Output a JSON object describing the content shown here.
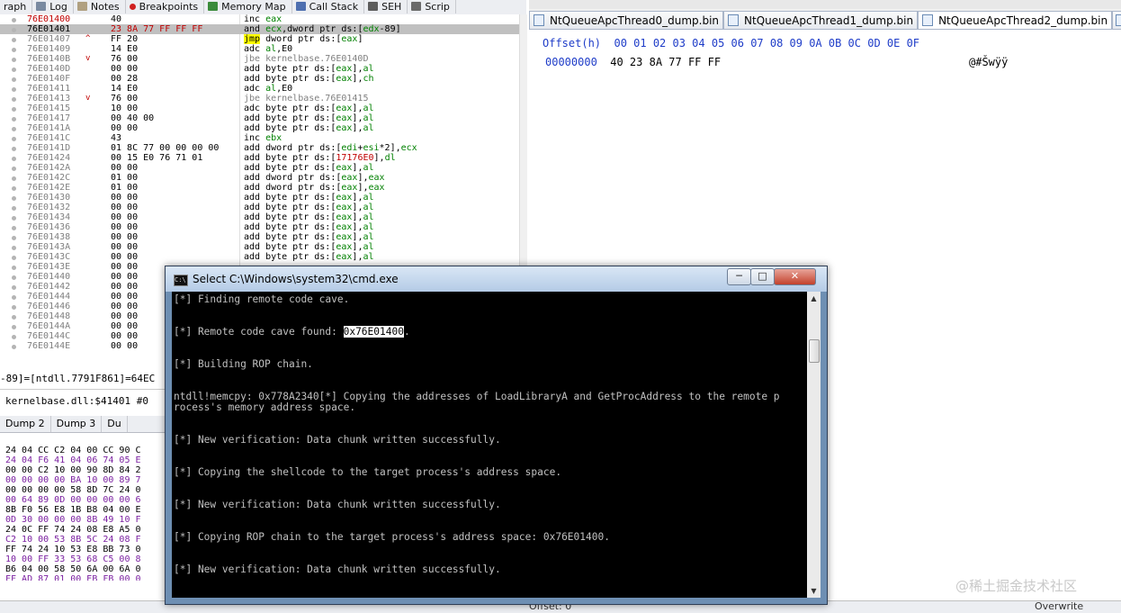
{
  "debugger_tabs": [
    {
      "icon": "graph-icon",
      "label": "raph"
    },
    {
      "icon": "log-icon",
      "label": "Log"
    },
    {
      "icon": "notes-icon",
      "label": "Notes"
    },
    {
      "icon": "breakpoint-icon",
      "label": "Breakpoints"
    },
    {
      "icon": "memory-map-icon",
      "label": "Memory Map"
    },
    {
      "icon": "call-stack-icon",
      "label": "Call Stack"
    },
    {
      "icon": "seh-icon",
      "label": "SEH"
    },
    {
      "icon": "script-icon",
      "label": "Scrip"
    }
  ],
  "disasm_rows": [
    {
      "addr": "76E01400",
      "mk": "",
      "bytes": "40",
      "ins": "inc eax",
      "sel": false,
      "addr_red": true
    },
    {
      "addr": "76E01401",
      "mk": "",
      "bytes": "23 8A 77 FF FF FF",
      "ins": "and ecx,dword ptr ds:[edx-89]",
      "sel": true,
      "addr_red": false
    },
    {
      "addr": "76E01407",
      "mk": "^",
      "bytes": "FF 20",
      "ins": "jmp dword ptr ds:[eax]",
      "sel": false,
      "addr_red": false
    },
    {
      "addr": "76E01409",
      "mk": "",
      "bytes": "14 E0",
      "ins": "adc al,E0",
      "sel": false,
      "addr_red": false
    },
    {
      "addr": "76E0140B",
      "mk": "v",
      "bytes": "76 00",
      "ins": "jbe kernelbase.76E0140D",
      "sel": false,
      "addr_red": false
    },
    {
      "addr": "76E0140D",
      "mk": "",
      "bytes": "00 00",
      "ins": "add byte ptr ds:[eax],al",
      "sel": false,
      "addr_red": false
    },
    {
      "addr": "76E0140F",
      "mk": "",
      "bytes": "00 28",
      "ins": "add byte ptr ds:[eax],ch",
      "sel": false,
      "addr_red": false
    },
    {
      "addr": "76E01411",
      "mk": "",
      "bytes": "14 E0",
      "ins": "adc al,E0",
      "sel": false,
      "addr_red": false
    },
    {
      "addr": "76E01413",
      "mk": "v",
      "bytes": "76 00",
      "ins": "jbe kernelbase.76E01415",
      "sel": false,
      "addr_red": false
    },
    {
      "addr": "76E01415",
      "mk": "",
      "bytes": "10 00",
      "ins": "adc byte ptr ds:[eax],al",
      "sel": false,
      "addr_red": false
    },
    {
      "addr": "76E01417",
      "mk": "",
      "bytes": "00 40 00",
      "ins": "add byte ptr ds:[eax],al",
      "sel": false,
      "addr_red": false
    },
    {
      "addr": "76E0141A",
      "mk": "",
      "bytes": "00 00",
      "ins": "add byte ptr ds:[eax],al",
      "sel": false,
      "addr_red": false
    },
    {
      "addr": "76E0141C",
      "mk": "",
      "bytes": "43",
      "ins": "inc ebx",
      "sel": false,
      "addr_red": false
    },
    {
      "addr": "76E0141D",
      "mk": "",
      "bytes": "01 8C 77 00 00 00 00",
      "ins": "add dword ptr ds:[edi+esi*2],ecx",
      "sel": false,
      "addr_red": false
    },
    {
      "addr": "76E01424",
      "mk": "",
      "bytes": "00 15 E0 76 71 01",
      "ins": "add byte ptr ds:[17176E0],dl",
      "sel": false,
      "addr_red": false
    },
    {
      "addr": "76E0142A",
      "mk": "",
      "bytes": "00 00",
      "ins": "add byte ptr ds:[eax],al",
      "sel": false,
      "addr_red": false
    },
    {
      "addr": "76E0142C",
      "mk": "",
      "bytes": "01 00",
      "ins": "add dword ptr ds:[eax],eax",
      "sel": false,
      "addr_red": false
    },
    {
      "addr": "76E0142E",
      "mk": "",
      "bytes": "01 00",
      "ins": "add dword ptr ds:[eax],eax",
      "sel": false,
      "addr_red": false
    },
    {
      "addr": "76E01430",
      "mk": "",
      "bytes": "00 00",
      "ins": "add byte ptr ds:[eax],al",
      "sel": false,
      "addr_red": false
    },
    {
      "addr": "76E01432",
      "mk": "",
      "bytes": "00 00",
      "ins": "add byte ptr ds:[eax],al",
      "sel": false,
      "addr_red": false
    },
    {
      "addr": "76E01434",
      "mk": "",
      "bytes": "00 00",
      "ins": "add byte ptr ds:[eax],al",
      "sel": false,
      "addr_red": false
    },
    {
      "addr": "76E01436",
      "mk": "",
      "bytes": "00 00",
      "ins": "add byte ptr ds:[eax],al",
      "sel": false,
      "addr_red": false
    },
    {
      "addr": "76E01438",
      "mk": "",
      "bytes": "00 00",
      "ins": "add byte ptr ds:[eax],al",
      "sel": false,
      "addr_red": false
    },
    {
      "addr": "76E0143A",
      "mk": "",
      "bytes": "00 00",
      "ins": "add byte ptr ds:[eax],al",
      "sel": false,
      "addr_red": false
    },
    {
      "addr": "76E0143C",
      "mk": "",
      "bytes": "00 00",
      "ins": "add byte ptr ds:[eax],al",
      "sel": false,
      "addr_red": false
    },
    {
      "addr": "76E0143E",
      "mk": "",
      "bytes": "00 00",
      "ins": "",
      "sel": false,
      "addr_red": false
    },
    {
      "addr": "76E01440",
      "mk": "",
      "bytes": "00 00",
      "ins": "",
      "sel": false,
      "addr_red": false
    },
    {
      "addr": "76E01442",
      "mk": "",
      "bytes": "00 00",
      "ins": "",
      "sel": false,
      "addr_red": false
    },
    {
      "addr": "76E01444",
      "mk": "",
      "bytes": "00 00",
      "ins": "",
      "sel": false,
      "addr_red": false
    },
    {
      "addr": "76E01446",
      "mk": "",
      "bytes": "00 00",
      "ins": "",
      "sel": false,
      "addr_red": false
    },
    {
      "addr": "76E01448",
      "mk": "",
      "bytes": "00 00",
      "ins": "",
      "sel": false,
      "addr_red": false
    },
    {
      "addr": "76E0144A",
      "mk": "",
      "bytes": "00 00",
      "ins": "",
      "sel": false,
      "addr_red": false
    },
    {
      "addr": "76E0144C",
      "mk": "",
      "bytes": "00 00",
      "ins": "",
      "sel": false,
      "addr_red": false
    },
    {
      "addr": "76E0144E",
      "mk": "",
      "bytes": "00 00",
      "ins": "",
      "sel": false,
      "addr_red": false
    }
  ],
  "info": {
    "line1": "-89]=[ntdll.7791F861]=64EC",
    "line2": "kernelbase.dll:$41401 #0"
  },
  "dump_tabs": [
    "Dump 2",
    "Dump 3",
    "Du"
  ],
  "dump_rows": [
    "24 04 CC C2 04 00 CC 90 C",
    "24 04 F6 41 04 06 74 05 E",
    "00 00 C2 10 00 90 8D 84 2",
    "00 00 00 00 BA 10 00 89 7",
    "00 00 00 00 58 8D 7C 24 0",
    "00 64 89 0D 00 00 00 00 6",
    "8B F0 56 E8 1B B8 04 00 E",
    "0D 30 00 00 00 8B 49 10 F",
    "24 0C FF 74 24 08 E8 A5 0",
    "C2 10 00 53 8B 5C 24 08 F",
    "FF 74 24 10 53 E8 BB 73 0",
    "10 00 FF 33 53 68 C5 00 8",
    "B6 04 00 58 50 6A 00 6A 0",
    "FF AD 87 01 00 EB FB 00 0"
  ],
  "hex_tabs": [
    {
      "label": "NtQueueApcThread0_dump.bin",
      "active": false
    },
    {
      "label": "NtQueueApcThread1_dump.bin",
      "active": false
    },
    {
      "label": "NtQueueApcThread2_dump.bin",
      "active": true
    }
  ],
  "hex": {
    "header": "Offset(h)  00 01 02 03 04 05 06 07 08 09 0A 0B 0C 0D 0E 0F",
    "offset": "00000000",
    "bytes": "40 23 8A 77 FF FF",
    "ascii": "@#Šwÿÿ",
    "status_offset": "Offset: 0",
    "mode": "Overwrite"
  },
  "cmd": {
    "title": "Select C:\\Windows\\system32\\cmd.exe",
    "icon_text": "C:\\",
    "lines": [
      {
        "pre": "[*] Finding remote code cave.",
        "hl": "",
        "post": ""
      },
      {
        "pre": "",
        "hl": "",
        "post": ""
      },
      {
        "pre": "",
        "hl": "",
        "post": ""
      },
      {
        "pre": "[*] Remote code cave found: ",
        "hl": "0x76E01400",
        "post": "."
      },
      {
        "pre": "",
        "hl": "",
        "post": ""
      },
      {
        "pre": "",
        "hl": "",
        "post": ""
      },
      {
        "pre": "[*] Building ROP chain.",
        "hl": "",
        "post": ""
      },
      {
        "pre": "",
        "hl": "",
        "post": ""
      },
      {
        "pre": "",
        "hl": "",
        "post": ""
      },
      {
        "pre": "ntdll!memcpy: 0x778A2340[*] Copying the addresses of LoadLibraryA and GetProcAddress to the remote p",
        "hl": "",
        "post": ""
      },
      {
        "pre": "rocess's memory address space.",
        "hl": "",
        "post": ""
      },
      {
        "pre": "",
        "hl": "",
        "post": ""
      },
      {
        "pre": "",
        "hl": "",
        "post": ""
      },
      {
        "pre": "[*] New verification: Data chunk written successfully.",
        "hl": "",
        "post": ""
      },
      {
        "pre": "",
        "hl": "",
        "post": ""
      },
      {
        "pre": "",
        "hl": "",
        "post": ""
      },
      {
        "pre": "[*] Copying the shellcode to the target process's address space.",
        "hl": "",
        "post": ""
      },
      {
        "pre": "",
        "hl": "",
        "post": ""
      },
      {
        "pre": "",
        "hl": "",
        "post": ""
      },
      {
        "pre": "[*] New verification: Data chunk written successfully.",
        "hl": "",
        "post": ""
      },
      {
        "pre": "",
        "hl": "",
        "post": ""
      },
      {
        "pre": "",
        "hl": "",
        "post": ""
      },
      {
        "pre": "[*] Copying ROP chain to the target process's address space: 0x76E01400.",
        "hl": "",
        "post": ""
      },
      {
        "pre": "",
        "hl": "",
        "post": ""
      },
      {
        "pre": "",
        "hl": "",
        "post": ""
      },
      {
        "pre": "[*] New verification: Data chunk written successfully.",
        "hl": "",
        "post": ""
      }
    ],
    "minimize": "─",
    "maximize": "□",
    "close": "✕"
  },
  "watermark": "@稀土掘金技术社区",
  "colors": {
    "keyword_jmp_bg": "#ffff00",
    "register_green": "#008000",
    "highlight_addr_red": "#c00000",
    "hex_blue": "#1e3cc8"
  }
}
